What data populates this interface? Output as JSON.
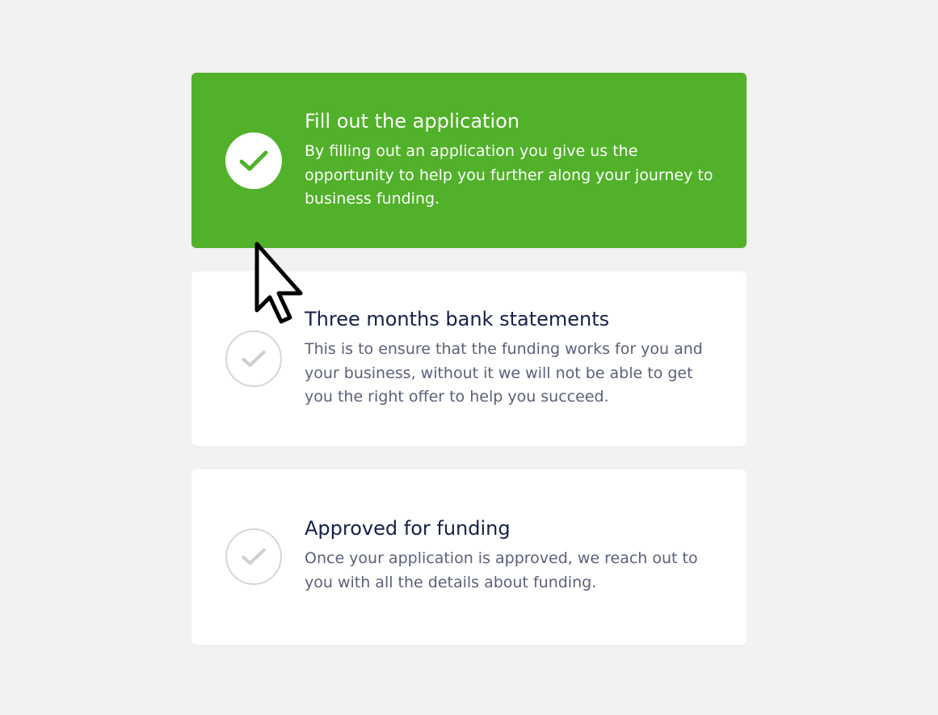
{
  "steps": [
    {
      "title": "Fill out the application",
      "description": "By filling out an application you give us the opportunity to help you further along your journey to business funding.",
      "status": "completed",
      "color": "#51b12a"
    },
    {
      "title": "Three months bank statements",
      "description": "This is to ensure that the funding works for you and your business, without it we will not be able to get you the right offer to help you succeed.",
      "status": "pending"
    },
    {
      "title": "Approved for funding",
      "description": "Once your application is approved, we reach out to you with all the details about funding.",
      "status": "pending"
    }
  ],
  "icons": {
    "step_check": "check-circle-icon",
    "cursor": "mouse-pointer-icon"
  }
}
